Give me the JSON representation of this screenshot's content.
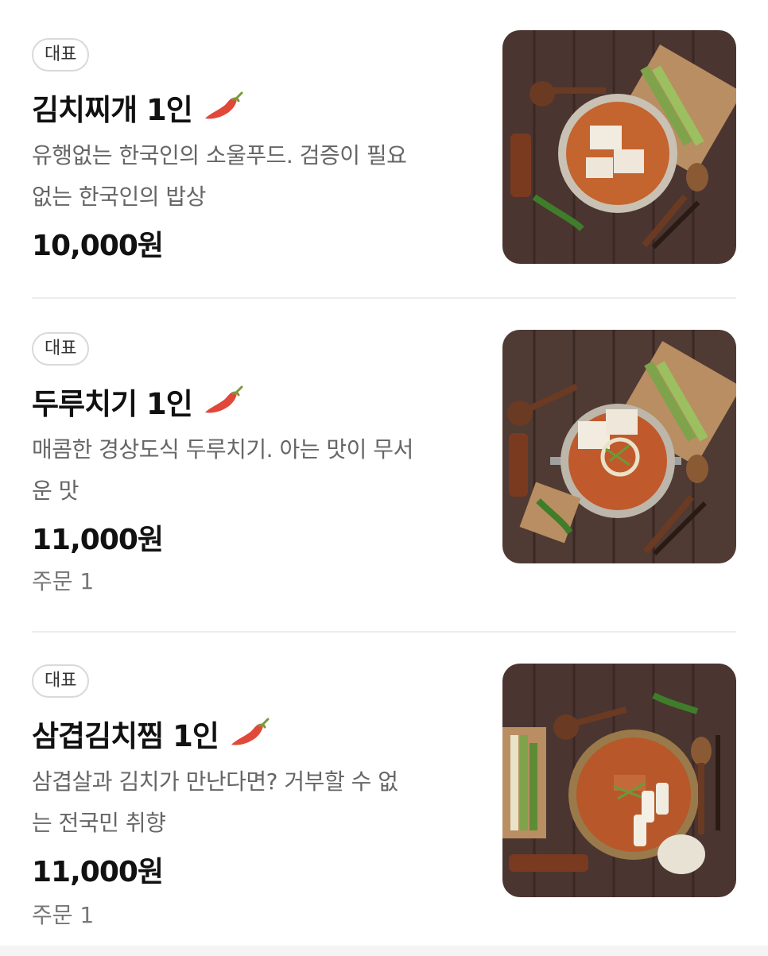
{
  "menu": [
    {
      "badge": "대표",
      "name": "김치찌개 1인",
      "description_line1": "유행없는 한국인의 소울푸드. 검증이 필요",
      "description_line2": "없는 한국인의 밥상",
      "price": "10,000원",
      "orders": "",
      "spicy_icon": "chili-pepper-icon"
    },
    {
      "badge": "대표",
      "name": "두루치기 1인",
      "description_line1": "매콤한 경상도식 두루치기. 아는 맛이 무서",
      "description_line2": "운 맛",
      "price": "11,000원",
      "orders": "주문 1",
      "spicy_icon": "chili-pepper-icon"
    },
    {
      "badge": "대표",
      "name": "삼겹김치찜 1인",
      "description_line1": "삼겹살과 김치가 만난다면? 거부할 수 없",
      "description_line2": "는 전국민 취향",
      "price": "11,000원",
      "orders": "주문 1",
      "spicy_icon": "chili-pepper-icon"
    }
  ],
  "colors": {
    "wood_dark": "#4a3530",
    "wood_light": "#6e554d",
    "stew": "#c4642e",
    "chili_red": "#e0483a"
  }
}
